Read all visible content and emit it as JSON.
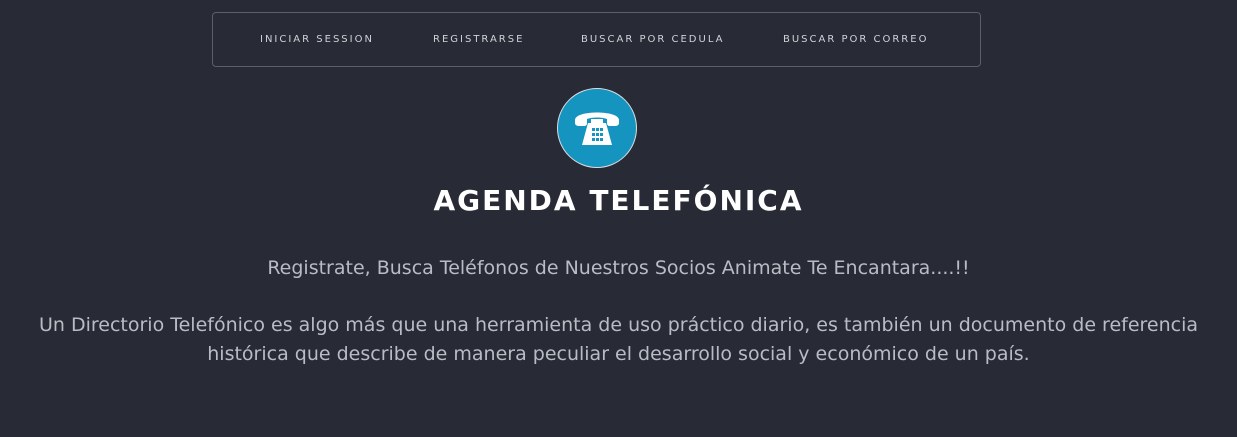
{
  "nav": {
    "login": "INICIAR SESSION",
    "register": "REGISTRARSE",
    "search_cedula": "BUSCAR POR CEDULA",
    "search_email": "BUSCAR POR CORREO"
  },
  "logo": {
    "icon": "telephone-icon",
    "background_color": "#1594c0"
  },
  "hero": {
    "title": "AGENDA TELEFÓNICA",
    "subtitle": "Registrate, Busca Teléfonos de Nuestros Socios Animate Te Encantara....!!",
    "description": "Un Directorio Telefónico es algo más que una herramienta de uso práctico diario, es también un documento de referencia histórica que describe de manera peculiar el desarrollo social y económico de un país."
  },
  "colors": {
    "page_background": "#282b35",
    "nav_border": "#5b5f69",
    "heading": "#ffffff",
    "body_text": "#b8bcc4"
  }
}
